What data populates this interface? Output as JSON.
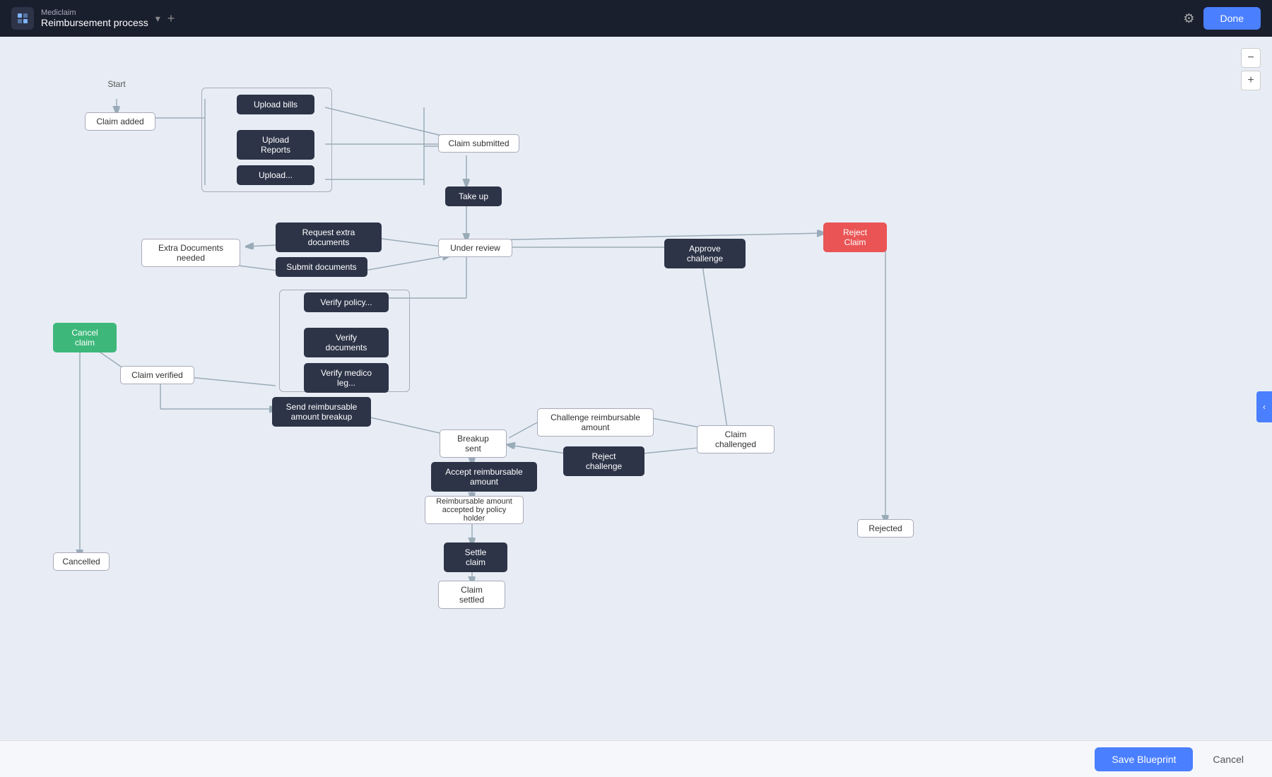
{
  "header": {
    "app_name": "Mediclaim",
    "process_name": "Reimbursement process",
    "done_label": "Done",
    "gear_icon": "⚙"
  },
  "zoom": {
    "minus_label": "−",
    "plus_label": "+"
  },
  "nodes": {
    "start": "Start",
    "claim_added": "Claim added",
    "upload_bills": "Upload bills",
    "upload_reports": "Upload Reports",
    "upload_other": "Upload...",
    "claim_submitted": "Claim submitted",
    "take_up": "Take up",
    "under_review": "Under review",
    "request_extra_docs": "Request extra documents",
    "extra_docs_needed": "Extra Documents needed",
    "submit_documents": "Submit documents",
    "cancel_claim": "Cancel claim",
    "claim_verified": "Claim verified",
    "verify_policy": "Verify policy...",
    "verify_documents": "Verify documents",
    "verify_medico": "Verify medico leg...",
    "send_reimbursable": "Send reimbursable amount breakup",
    "breakup_sent": "Breakup sent",
    "challenge_reimbursable": "Challenge reimbursable amount",
    "claim_challenged": "Claim challenged",
    "reject_challenge": "Reject challenge",
    "approve_challenge": "Approve challenge",
    "accept_reimbursable": "Accept reimbursable amount",
    "reimbursable_accepted": "Reimbursable amount accepted by policy holder",
    "settle_claim": "Settle claim",
    "claim_settled": "Claim settled",
    "reject_claim": "Reject Claim",
    "rejected": "Rejected",
    "cancelled": "Cancelled"
  },
  "bottom": {
    "save_label": "Save Blueprint",
    "cancel_label": "Cancel"
  },
  "side_toggle": "‹"
}
